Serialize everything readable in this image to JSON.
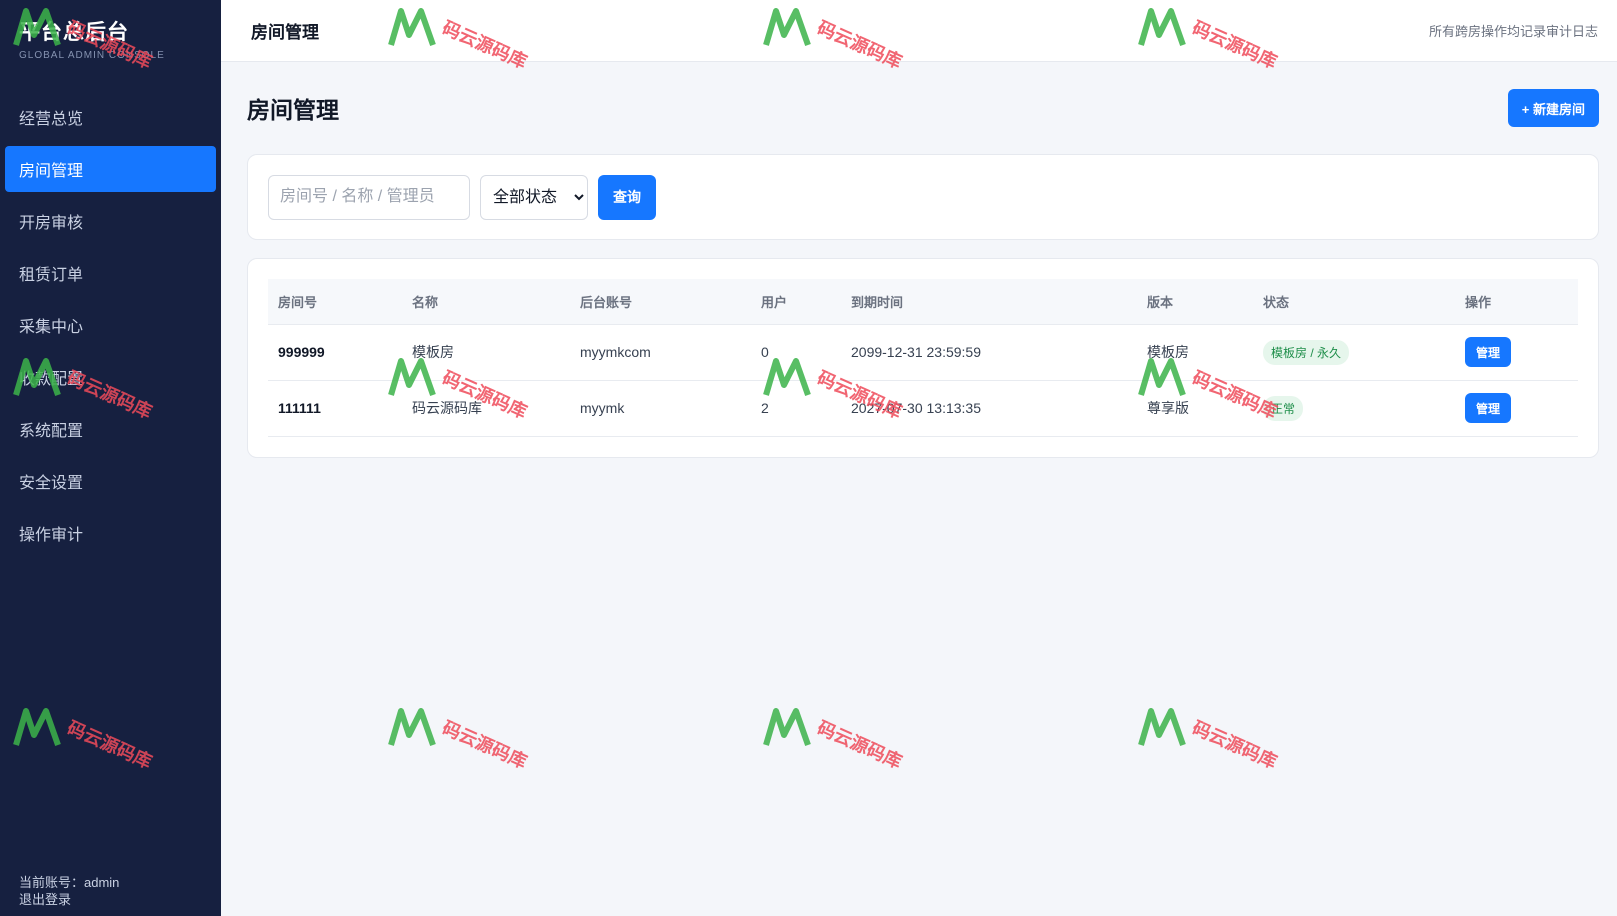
{
  "sidebar": {
    "brand_title": "平台总后台",
    "brand_sub": "GLOBAL ADMIN CONSOLE",
    "items": [
      {
        "label": "经营总览",
        "active": false
      },
      {
        "label": "房间管理",
        "active": true
      },
      {
        "label": "开房审核",
        "active": false
      },
      {
        "label": "租赁订单",
        "active": false
      },
      {
        "label": "采集中心",
        "active": false
      },
      {
        "label": "收款配置",
        "active": false
      },
      {
        "label": "系统配置",
        "active": false
      },
      {
        "label": "安全设置",
        "active": false
      },
      {
        "label": "操作审计",
        "active": false
      }
    ],
    "current_account": "当前账号：admin",
    "logout": "退出登录"
  },
  "topbar": {
    "title": "房间管理",
    "note": "所有跨房操作均记录审计日志"
  },
  "page": {
    "title": "房间管理",
    "new_room_button": "+ 新建房间"
  },
  "filter": {
    "search_placeholder": "房间号 / 名称 / 管理员",
    "status_selected": "全部状态",
    "query_button": "查询"
  },
  "table": {
    "headers": [
      "房间号",
      "名称",
      "后台账号",
      "用户",
      "到期时间",
      "版本",
      "状态",
      "操作"
    ],
    "rows": [
      {
        "room_no": "999999",
        "name": "模板房",
        "account": "myymkcom",
        "users": "0",
        "expire": "2099-12-31 23:59:59",
        "edition": "模板房",
        "status": "模板房 / 永久",
        "action": "管理"
      },
      {
        "room_no": "111111",
        "name": "码云源码库",
        "account": "myymk",
        "users": "2",
        "expire": "2027-07-30 13:13:35",
        "edition": "尊享版",
        "status": "正常",
        "action": "管理"
      }
    ]
  },
  "watermark": {
    "text": "码云源码库"
  },
  "colors": {
    "sidebar_bg": "#162040",
    "accent": "#1677ff",
    "badge_bg": "#e6f6ec",
    "badge_text": "#1e8e4a",
    "page_bg": "#f4f6fa"
  }
}
